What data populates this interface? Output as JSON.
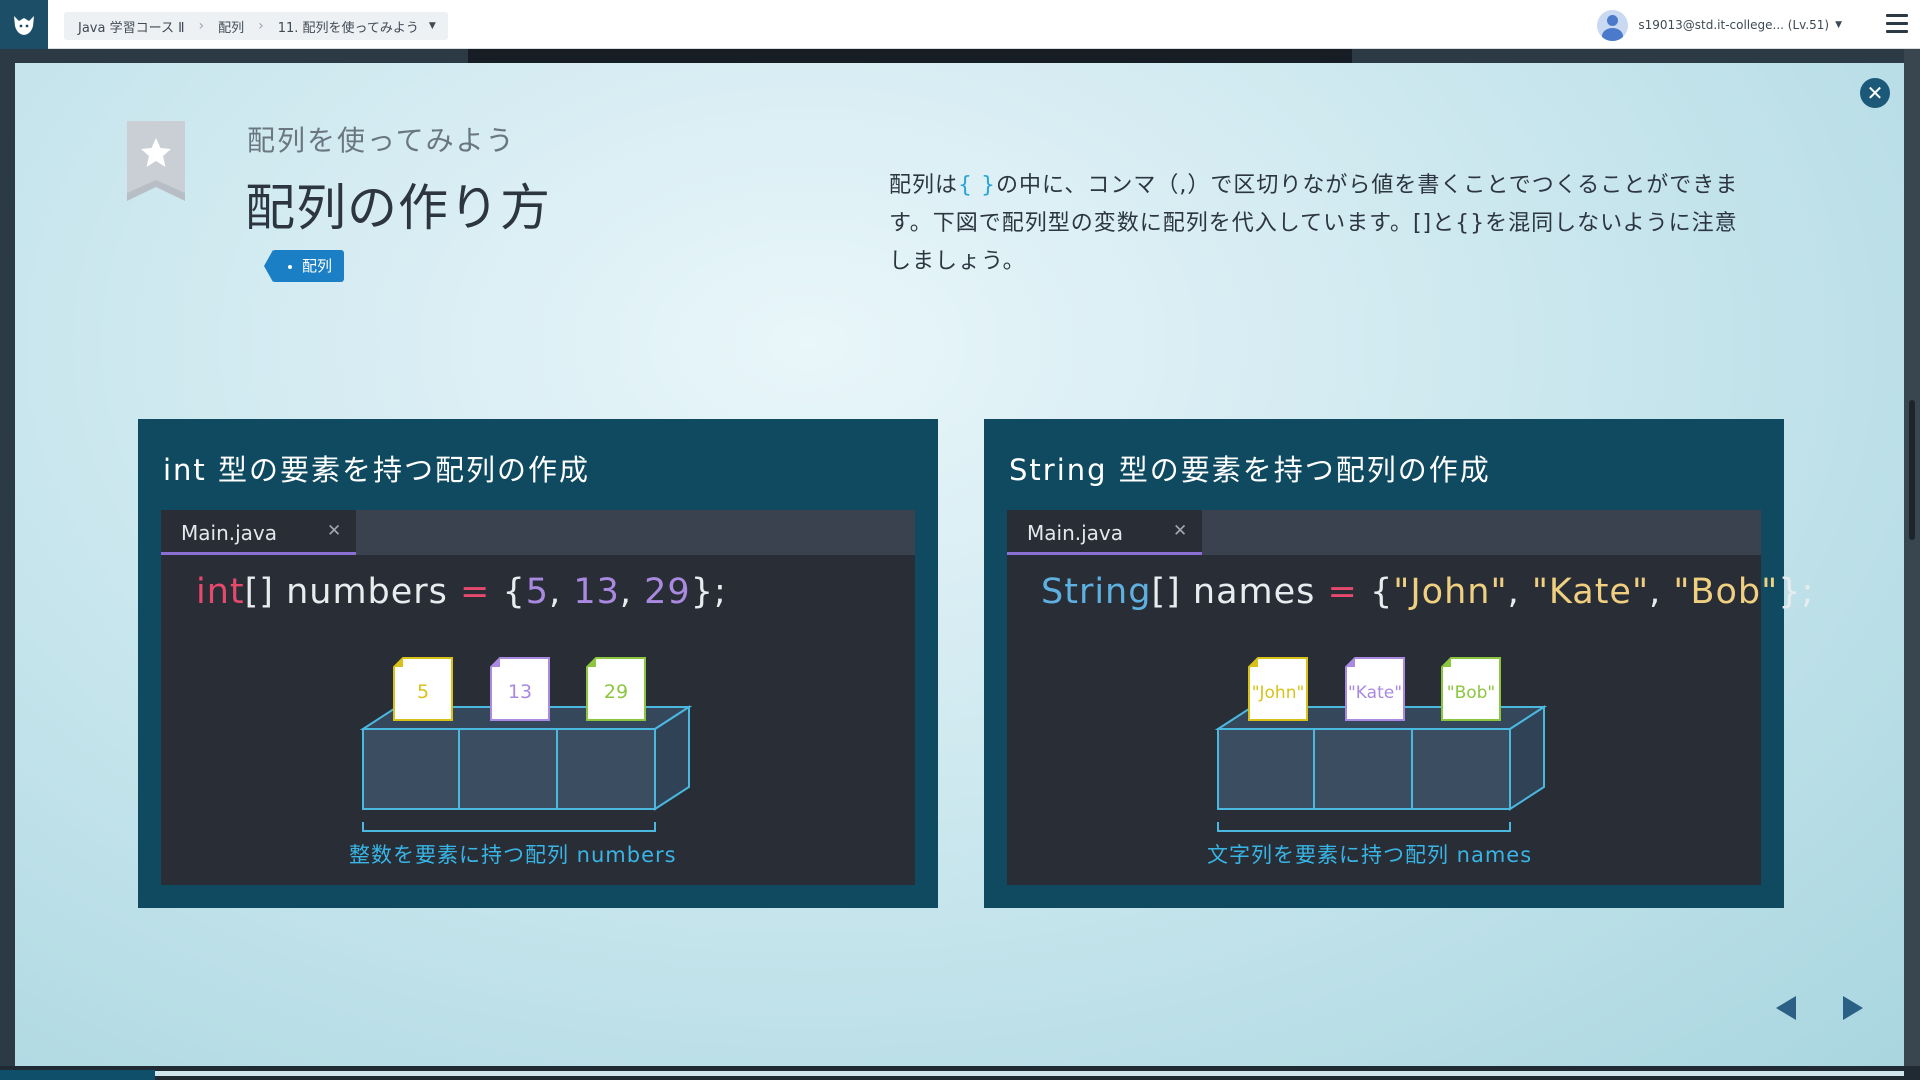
{
  "topbar": {
    "logo_icon": "fox-logo-icon",
    "breadcrumb": [
      "Java 学習コース Ⅱ",
      "配列",
      "11. 配列を使ってみよう"
    ],
    "user_label": "s19013@std.it-college... (Lv.51)"
  },
  "lesson": {
    "subtitle": "配列を使ってみよう",
    "title": "配列の作り方",
    "tag": "配列",
    "description": {
      "part1": "配列は",
      "braces": "{ }",
      "part2": "の中に、コンマ（,）で区切りながら値を書くことでつくることができます。下図で配列型の変数に配列を代入しています。[]と{}を混同しないように注意しましょう。"
    }
  },
  "panels": [
    {
      "title": "int 型の要素を持つ配列の作成",
      "tab": "Main.java",
      "code": {
        "type": "int",
        "brackets": "[] numbers ",
        "eq": "=",
        "open": " {",
        "v1": "5",
        "sep1": ", ",
        "v2": "13",
        "sep2": ", ",
        "v3": "29",
        "close": "};"
      },
      "cards": [
        "5",
        "13",
        "29"
      ],
      "card_colors": [
        "#d8c21a",
        "#a98ae0",
        "#8cc63f"
      ],
      "caption": "整数を要素に持つ配列 numbers"
    },
    {
      "title": "String 型の要素を持つ配列の作成",
      "tab": "Main.java",
      "code": {
        "type": "String",
        "brackets": "[] names ",
        "eq": "=",
        "open": " {",
        "v1": "\"John\"",
        "sep1": ", ",
        "v2": "\"Kate\"",
        "sep2": ", ",
        "v3": "\"Bob\"",
        "close": "};"
      },
      "cards": [
        "\"John\"",
        "\"Kate\"",
        "\"Bob\""
      ],
      "card_colors": [
        "#d8c21a",
        "#a98ae0",
        "#8cc63f"
      ],
      "caption": "文字列を要素に持つ配列 names"
    }
  ],
  "colors": {
    "accent": "#1a7fc4",
    "panel_bg": "#0f4a61",
    "editor_bg": "#292d36",
    "box_stroke": "#4bb8e0"
  },
  "icons": {
    "close": "close-icon",
    "bookmark": "star-bookmark-icon",
    "prev": "prev-arrow-icon",
    "next": "next-arrow-icon",
    "menu": "hamburger-menu-icon"
  }
}
